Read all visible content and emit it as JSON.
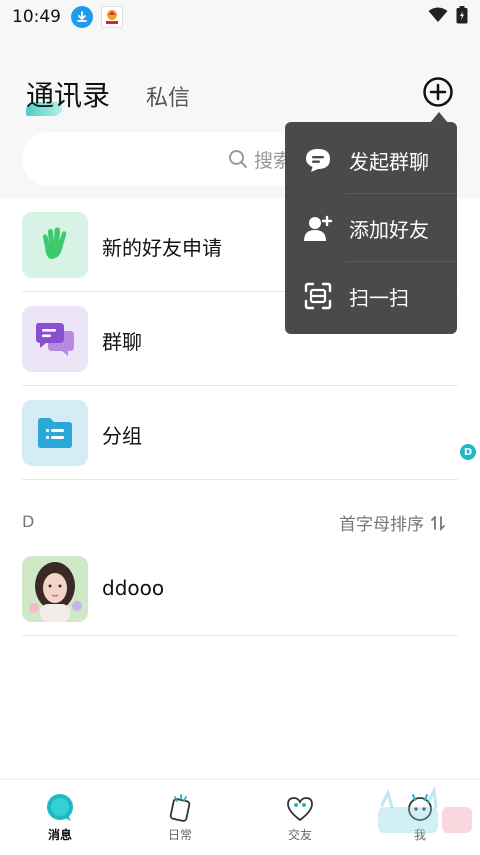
{
  "status_bar": {
    "time": "10:49"
  },
  "header": {
    "tab_contacts": "通讯录",
    "tab_messages": "私信"
  },
  "search": {
    "placeholder": "搜索"
  },
  "list": {
    "items": [
      {
        "label": "新的好友申请",
        "icon": "wave-hand-icon"
      },
      {
        "label": "群聊",
        "icon": "group-chat-icon"
      },
      {
        "label": "分组",
        "icon": "folder-icon"
      }
    ],
    "section_letter": "D",
    "sort_label": "首字母排序",
    "index_letter": "D",
    "contacts": [
      {
        "name": "ddooo"
      }
    ]
  },
  "popup": {
    "items": [
      {
        "label": "发起群聊",
        "icon": "chat-bubble-icon"
      },
      {
        "label": "添加好友",
        "icon": "add-user-icon"
      },
      {
        "label": "扫一扫",
        "icon": "scan-icon"
      }
    ]
  },
  "bottom_nav": {
    "items": [
      {
        "label": "消息",
        "active": true
      },
      {
        "label": "日常",
        "active": false
      },
      {
        "label": "交友",
        "active": false
      },
      {
        "label": "我",
        "active": false
      }
    ]
  },
  "colors": {
    "accent": "#23c4b5",
    "popup_bg": "#4a4a4a",
    "badge": "#1fb8c4"
  }
}
